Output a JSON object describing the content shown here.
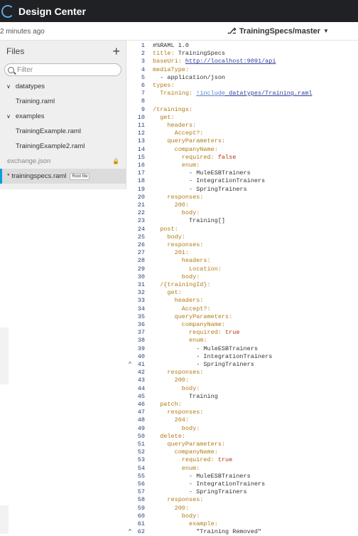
{
  "app": {
    "title": "Design Center"
  },
  "subbar": {
    "saved_text": "2 minutes ago",
    "branch_label": "TrainingSpecs/master"
  },
  "sidebar": {
    "files_title": "Files",
    "add_label": "+",
    "filter_placeholder": "Filter",
    "rows": [
      {
        "kind": "folder",
        "label": "datatypes"
      },
      {
        "kind": "file",
        "label": "Training.raml"
      },
      {
        "kind": "folder",
        "label": "examples"
      },
      {
        "kind": "file",
        "label": "TrainingExample.raml"
      },
      {
        "kind": "file",
        "label": "TrainingExample2.raml"
      },
      {
        "kind": "root-file",
        "label": "exchange.json",
        "locked": true
      },
      {
        "kind": "selected",
        "label": "* trainingspecs.raml",
        "badge": "Root file"
      }
    ]
  },
  "editor": {
    "lines": [
      [
        {
          "t": "#%RAML 1.0",
          "c": "s"
        }
      ],
      [
        {
          "t": "title: ",
          "c": "k"
        },
        {
          "t": "TrainingSpecs",
          "c": "s"
        }
      ],
      [
        {
          "t": "baseUri: ",
          "c": "k"
        },
        {
          "t": "http://localhost:9091/api",
          "c": "u"
        }
      ],
      [
        {
          "t": "mediaType:",
          "c": "k"
        }
      ],
      [
        {
          "t": "  - application/json",
          "c": "s"
        }
      ],
      [
        {
          "t": "types:",
          "c": "k"
        }
      ],
      [
        {
          "t": "  Training: ",
          "c": "k"
        },
        {
          "t": "!include",
          "c": "inc"
        },
        {
          "t": " datatypes/Training.raml",
          "c": "u"
        }
      ],
      [
        {
          "t": "",
          "c": "s"
        }
      ],
      [
        {
          "t": "/trainings:",
          "c": "k"
        }
      ],
      [
        {
          "t": "  get:",
          "c": "k"
        }
      ],
      [
        {
          "t": "    headers:",
          "c": "k"
        }
      ],
      [
        {
          "t": "      Accept?:",
          "c": "k"
        }
      ],
      [
        {
          "t": "    queryParameters:",
          "c": "k"
        }
      ],
      [
        {
          "t": "      companyName:",
          "c": "k"
        }
      ],
      [
        {
          "t": "        required: ",
          "c": "k"
        },
        {
          "t": "false",
          "c": "red"
        }
      ],
      [
        {
          "t": "        enum:",
          "c": "k"
        }
      ],
      [
        {
          "t": "          - MuleESBTrainers",
          "c": "s"
        }
      ],
      [
        {
          "t": "          - IntegrationTrainers",
          "c": "s"
        }
      ],
      [
        {
          "t": "          - SpringTrainers",
          "c": "s"
        }
      ],
      [
        {
          "t": "    responses:",
          "c": "k"
        }
      ],
      [
        {
          "t": "      200:",
          "c": "k"
        }
      ],
      [
        {
          "t": "        body:",
          "c": "k"
        }
      ],
      [
        {
          "t": "          Training[]",
          "c": "s"
        }
      ],
      [
        {
          "t": "  post:",
          "c": "k"
        }
      ],
      [
        {
          "t": "    body:",
          "c": "k"
        }
      ],
      [
        {
          "t": "    responses:",
          "c": "k"
        }
      ],
      [
        {
          "t": "      201:",
          "c": "k"
        }
      ],
      [
        {
          "t": "        headers:",
          "c": "k"
        }
      ],
      [
        {
          "t": "          Location:",
          "c": "k"
        }
      ],
      [
        {
          "t": "        body:",
          "c": "k"
        }
      ],
      [
        {
          "t": "  /{trainingId}:",
          "c": "k"
        }
      ],
      [
        {
          "t": "    get:",
          "c": "k"
        }
      ],
      [
        {
          "t": "      headers:",
          "c": "k"
        }
      ],
      [
        {
          "t": "        Accept?:",
          "c": "k"
        }
      ],
      [
        {
          "t": "      queryParameters:",
          "c": "k"
        }
      ],
      [
        {
          "t": "        companyName:",
          "c": "k"
        }
      ],
      [
        {
          "t": "          required: ",
          "c": "k"
        },
        {
          "t": "true",
          "c": "red"
        }
      ],
      [
        {
          "t": "          enum:",
          "c": "k"
        }
      ],
      [
        {
          "t": "            - MuleESBTrainers",
          "c": "s"
        }
      ],
      [
        {
          "t": "            - IntegrationTrainers",
          "c": "s"
        }
      ],
      [
        {
          "t": "            - SpringTrainers",
          "c": "s"
        }
      ],
      [
        {
          "t": "    responses:",
          "c": "k"
        }
      ],
      [
        {
          "t": "      200:",
          "c": "k"
        }
      ],
      [
        {
          "t": "        body:",
          "c": "k"
        }
      ],
      [
        {
          "t": "          Training",
          "c": "s"
        }
      ],
      [
        {
          "t": "  patch:",
          "c": "k"
        }
      ],
      [
        {
          "t": "    responses:",
          "c": "k"
        }
      ],
      [
        {
          "t": "      204:",
          "c": "k"
        }
      ],
      [
        {
          "t": "        body:",
          "c": "k"
        }
      ],
      [
        {
          "t": "  delete:",
          "c": "k"
        }
      ],
      [
        {
          "t": "    queryParameters:",
          "c": "k"
        }
      ],
      [
        {
          "t": "      companyName:",
          "c": "k"
        }
      ],
      [
        {
          "t": "        required: ",
          "c": "k"
        },
        {
          "t": "true",
          "c": "red"
        }
      ],
      [
        {
          "t": "        enum:",
          "c": "k"
        }
      ],
      [
        {
          "t": "          - MuleESBTrainers",
          "c": "s"
        }
      ],
      [
        {
          "t": "          - IntegrationTrainers",
          "c": "s"
        }
      ],
      [
        {
          "t": "          - SpringTrainers",
          "c": "s"
        }
      ],
      [
        {
          "t": "    responses:",
          "c": "k"
        }
      ],
      [
        {
          "t": "      200:",
          "c": "k"
        }
      ],
      [
        {
          "t": "        body:",
          "c": "k"
        }
      ],
      [
        {
          "t": "          example:",
          "c": "k"
        }
      ],
      [
        {
          "t": "            \"Training Removed\"",
          "c": "s"
        }
      ]
    ],
    "line_numbers": [
      "1",
      "2",
      "3",
      "4",
      "5",
      "6",
      "7",
      "8",
      "9",
      "10",
      "11",
      "12",
      "13",
      "14",
      "15",
      "16",
      "17",
      "18",
      "19",
      "20",
      "21",
      "22",
      "23",
      "24",
      "25",
      "26",
      "27",
      "28",
      "29",
      "30",
      "31",
      "32",
      "33",
      "34",
      "35",
      "36",
      "37",
      "38",
      "39",
      "40",
      "41",
      "42",
      "43",
      "44",
      "45",
      "46",
      "47",
      "48",
      "49",
      "50",
      "51",
      "52",
      "53",
      "54",
      "55",
      "56",
      "57",
      "58",
      "59",
      "60",
      "61",
      "62"
    ],
    "fold_markers": [
      {
        "line": 41,
        "glyph": "^"
      },
      {
        "line": 62,
        "glyph": "^"
      }
    ]
  }
}
